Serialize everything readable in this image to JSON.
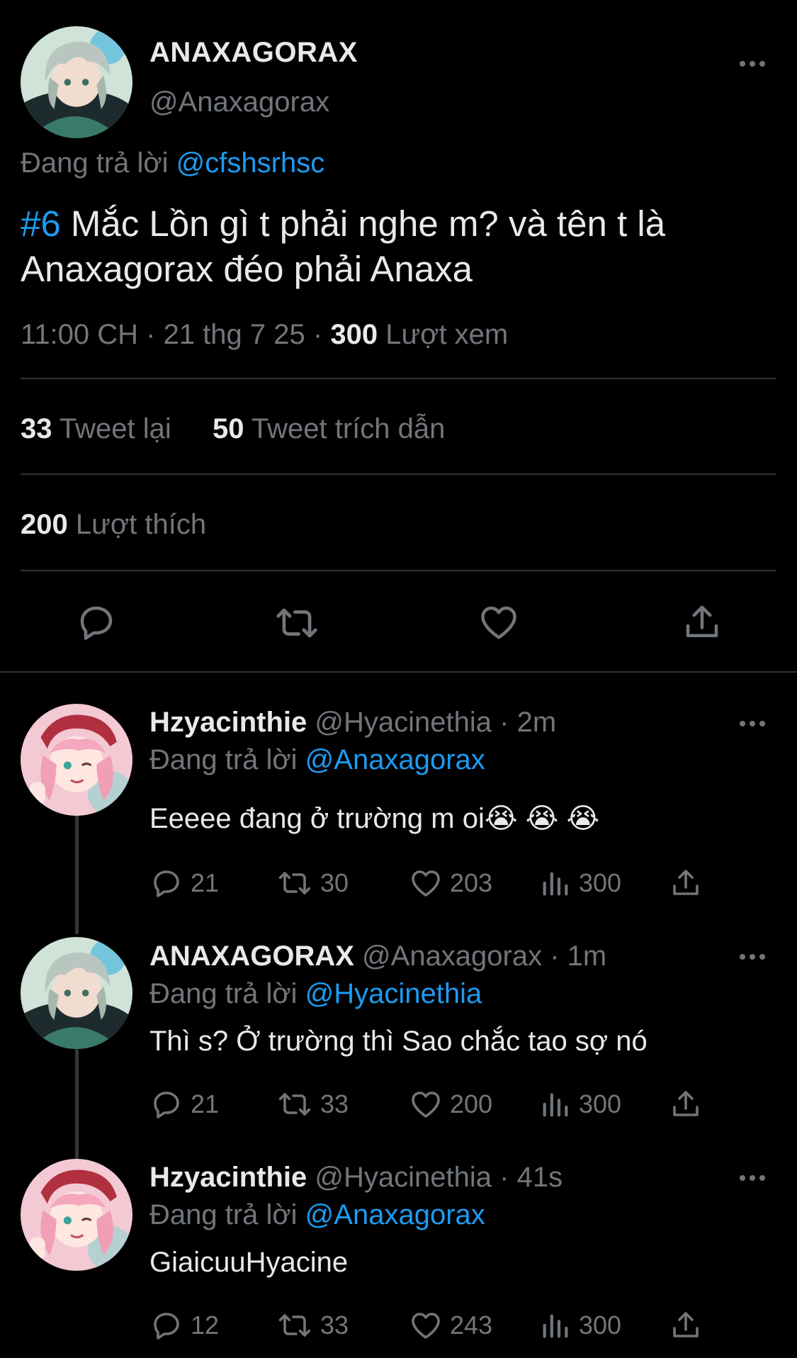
{
  "main_tweet": {
    "display_name": "ANAXAGORAX",
    "handle": "@Anaxagorax",
    "replying_prefix": "Đang trả lời",
    "replying_to": "@cfshsrhsc",
    "hashtag": "#6",
    "body_line1": " Mắc Lồn gì t phải nghe m? và tên t là",
    "body_line2": "Anaxagorax đéo phải Anaxa",
    "time": "11:00 CH",
    "date": "21 thg 7 25",
    "views_count": "300",
    "views_label": "Lượt xem",
    "retweets_count": "33",
    "retweets_label": "Tweet lại",
    "quotes_count": "50",
    "quotes_label": "Tweet trích dẫn",
    "likes_count": "200",
    "likes_label": "Lượt thích"
  },
  "replies": [
    {
      "display_name": "Hzyacinthie",
      "handle": "@Hyacinethia",
      "time": "2m",
      "replying_prefix": "Đang trả lời",
      "replying_to": "@Anaxagorax",
      "text": "Eeeee đang ở trường m oi😭 😭 😭",
      "replies": "21",
      "retweets": "30",
      "likes": "203",
      "views": "300"
    },
    {
      "display_name": "ANAXAGORAX",
      "handle": "@Anaxagorax",
      "time": "1m",
      "replying_prefix": "Đang trả lời",
      "replying_to": "@Hyacinethia",
      "text": "Thì s? Ở trường thì Sao chắc tao sợ nó",
      "replies": "21",
      "retweets": "33",
      "likes": "200",
      "views": "300"
    },
    {
      "display_name": "Hzyacinthie",
      "handle": "@Hyacinethia",
      "time": "41s",
      "replying_prefix": "Đang trả lời",
      "replying_to": "@Anaxagorax",
      "text": "GiaicuuHyacine",
      "replies": "12",
      "retweets": "33",
      "likes": "243",
      "views": "300"
    }
  ],
  "colors": {
    "background": "#000000",
    "accent": "#1d9bf0",
    "muted": "#71767b",
    "divider": "#2f3336"
  },
  "icons": [
    "more-icon",
    "reply-icon",
    "retweet-icon",
    "like-icon",
    "share-icon",
    "views-icon"
  ]
}
